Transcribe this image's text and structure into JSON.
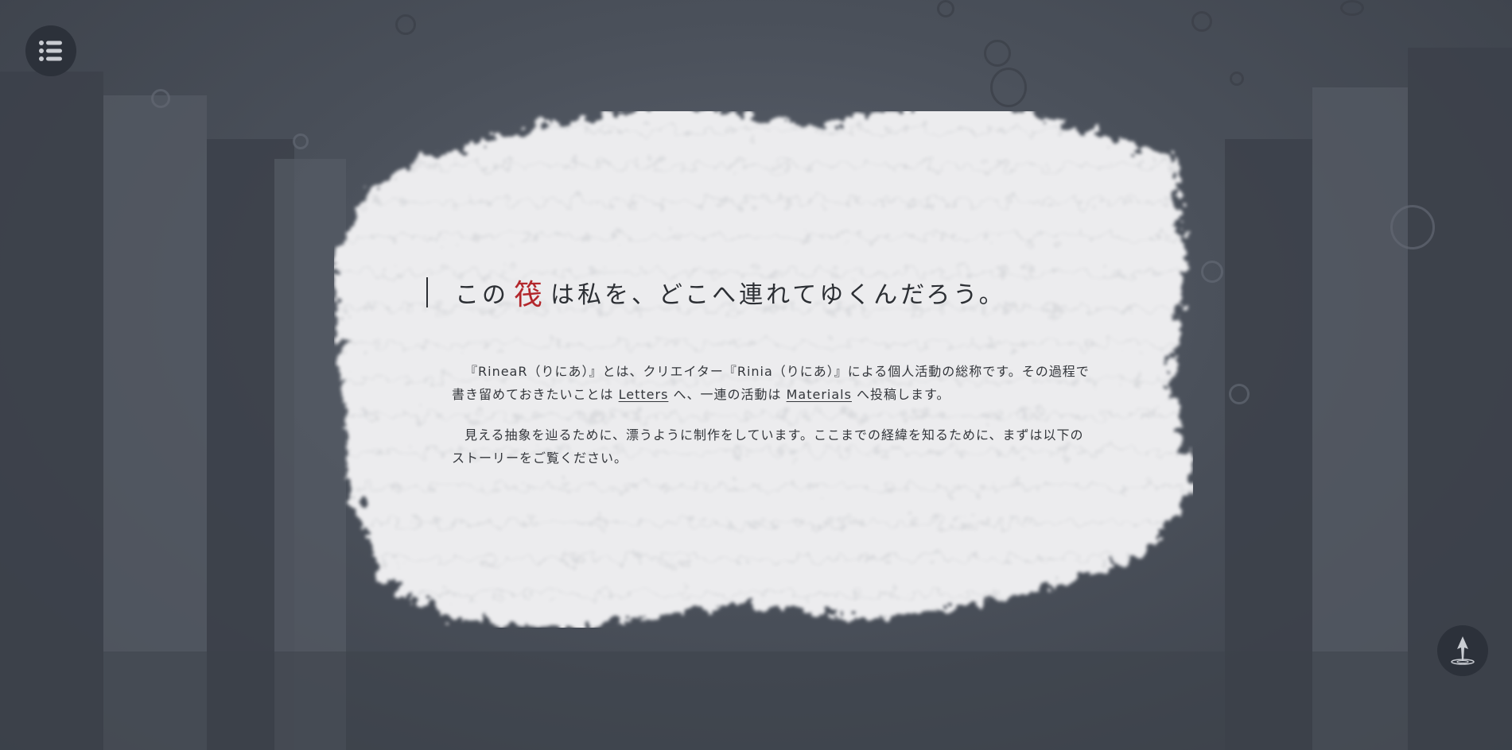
{
  "heading": {
    "prefix": "この",
    "accent": "筏",
    "suffix": "は私を、どこへ連れてゆくんだろう。"
  },
  "paragraph1": {
    "part1": "『RineaR（りにあ）』とは、クリエイター『Rinia（りにあ）』による個人活動の総称です。その過程で書き留めておきたいことは",
    "link_letters": "Letters",
    "part2": "へ、一連の活動は",
    "link_materials": "Materials",
    "part3": "へ投稿します。"
  },
  "paragraph2": {
    "text": "見える抽象を辿るために、漂うように制作をしています。ここまでの経緯を知るために、まずは以下のストーリーをご覧ください。"
  },
  "icons": {
    "menu": "list-menu-icon",
    "top": "scroll-to-top-icon"
  },
  "colors": {
    "background": "#474d57",
    "paper": "#ececee",
    "accent": "#b3272c",
    "button": "#2c313a"
  }
}
